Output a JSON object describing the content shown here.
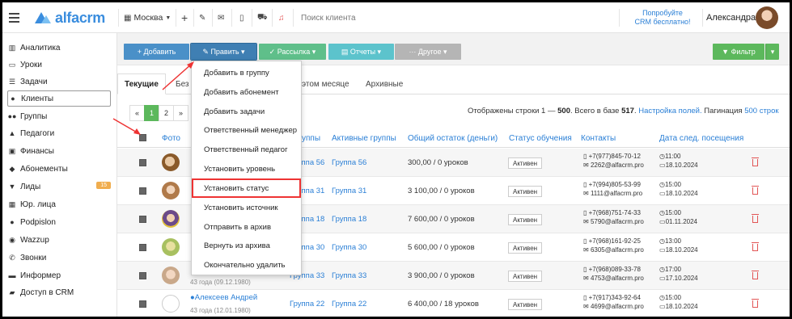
{
  "topbar": {
    "logo": "alfacrm",
    "branch": "Москва",
    "search_placeholder": "Поиск клиента",
    "promo_line1": "Попробуйте",
    "promo_line2": "CRM бесплатно!",
    "user_name": "Александра"
  },
  "sidebar": {
    "items": [
      {
        "label": "Аналитика",
        "icon": "map-icon"
      },
      {
        "label": "Уроки",
        "icon": "calendar-icon"
      },
      {
        "label": "Задачи",
        "icon": "tasks-icon"
      },
      {
        "label": "Клиенты",
        "icon": "user-icon"
      },
      {
        "label": "Группы",
        "icon": "group-icon"
      },
      {
        "label": "Педагоги",
        "icon": "graduation-cap-icon"
      },
      {
        "label": "Финансы",
        "icon": "money-icon"
      },
      {
        "label": "Абонементы",
        "icon": "tag-icon"
      },
      {
        "label": "Лиды",
        "icon": "funnel-icon",
        "badge": "15"
      },
      {
        "label": "Юр. лица",
        "icon": "building-icon"
      },
      {
        "label": "Podpislon",
        "icon": "circle-icon"
      },
      {
        "label": "Wazzup",
        "icon": "whatsapp-icon"
      },
      {
        "label": "Звонки",
        "icon": "phone-icon"
      },
      {
        "label": "Информер",
        "icon": "briefcase-icon"
      },
      {
        "label": "Доступ в CRM",
        "icon": "lock-icon"
      }
    ]
  },
  "toolbar": {
    "add": "+ Добавить",
    "edit": "✎ Править ▾",
    "mailing": "✓ Рассылка ▾",
    "reports": "▤ Отчеты ▾",
    "other": "··· Другое ▾",
    "filter": "▼ Фильтр",
    "filter_caret": "▾",
    "colors": {
      "blue": "#4a90c8",
      "green": "#5fbf8a",
      "teal": "#5cc3cc",
      "gray": "#b5b5b5",
      "filter": "#5cb85c"
    }
  },
  "tabs": {
    "current": "Текущие",
    "without": "Без",
    "this_month": "этом месяце",
    "archive": "Архивные"
  },
  "pager": {
    "prev": "«",
    "p1": "1",
    "p2": "2",
    "next": "»"
  },
  "info": {
    "shown_prefix": "Отображены строки 1 — ",
    "shown_to": "500",
    "total_prefix": ". Всего в базе ",
    "total": "517",
    "setup_link": "Настройка полей.",
    "pagination_label": " Пагинация ",
    "pagination_link": "500 строк"
  },
  "table": {
    "headers": {
      "photo": "Фото",
      "groups": "уппы",
      "active_groups": "Активные группы",
      "balance": "Общий остаток (деньги)",
      "status": "Статус обучения",
      "contacts": "Контакты",
      "next_visit": "Дата след. посещения"
    },
    "rows": [
      {
        "name": "",
        "sub": "",
        "group": "Группа 56",
        "active_group": "Группа 56",
        "balance": "300,00 / 0 уроков",
        "status": "Активен",
        "phone": "+7(977)845-70-12",
        "email": "2262@alfacrm.pro",
        "time": "11:00",
        "date": "18.10.2024"
      },
      {
        "name": "",
        "sub": "",
        "group": "Группа 31",
        "active_group": "Группа 31",
        "balance": "3 100,00 / 0 уроков",
        "status": "Активен",
        "phone": "+7(994)805-53-99",
        "email": "1111@alfacrm.pro",
        "time": "15:00",
        "date": "18.10.2024"
      },
      {
        "name": "",
        "sub": "",
        "group": "Группа 18",
        "active_group": "Группа 18",
        "balance": "7 600,00 / 0 уроков",
        "status": "Активен",
        "phone": "+7(968)751-74-33",
        "email": "5790@alfacrm.pro",
        "time": "15:00",
        "date": "01.11.2024"
      },
      {
        "name": "",
        "sub": "",
        "group": "Группа 30",
        "active_group": "Группа 30",
        "balance": "5 600,00 / 0 уроков",
        "status": "Активен",
        "phone": "+7(968)161-92-25",
        "email": "6305@alfacrm.pro",
        "time": "13:00",
        "date": "18.10.2024"
      },
      {
        "name": "",
        "sub": "43 года (09.12.1980)",
        "group": "Группа 33",
        "active_group": "Группа 33",
        "balance": "3 900,00 / 0 уроков",
        "status": "Активен",
        "phone": "+7(968)089-33-78",
        "email": "4753@alfacrm.pro",
        "time": "17:00",
        "date": "17.10.2024"
      },
      {
        "name": "Алексеев Андрей",
        "sub": "43 года (12.01.1980)",
        "group": "Группа 22",
        "active_group": "Группа 22",
        "balance": "6 400,00 / 18 уроков",
        "status": "Активен",
        "phone": "+7(917)343-92-64",
        "email": "4699@alfacrm.pro",
        "time": "15:00",
        "date": "18.10.2024"
      }
    ]
  },
  "dropdown": {
    "items": [
      "Добавить в группу",
      "Добавить абонемент",
      "Добавить задачи",
      "Ответственный менеджер",
      "Ответственный педагог",
      "Установить уровень",
      "Установить статус",
      "Установить источник",
      "Отправить в архив",
      "Вернуть из архива",
      "Окончательно удалить"
    ],
    "highlighted_index": 6
  }
}
